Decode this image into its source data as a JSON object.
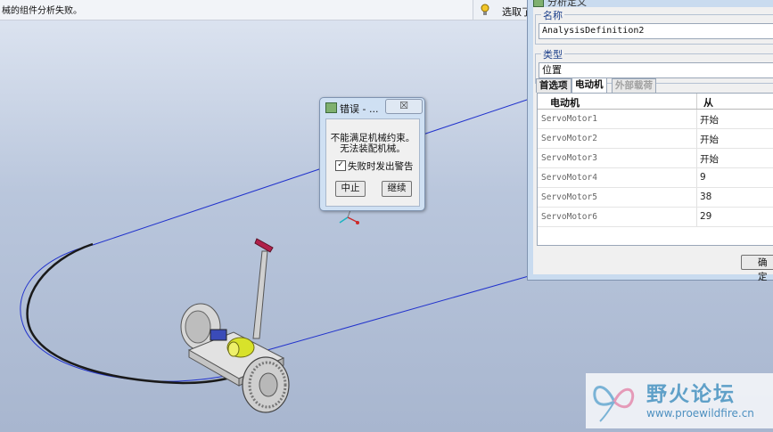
{
  "status_bar": {
    "message": "械的组件分析失败。",
    "select_label": "选取了"
  },
  "error_dialog": {
    "title": "错误 - ...",
    "close_glyph": "☒",
    "line1": "不能满足机械约束。",
    "line2": "无法装配机械。",
    "checkbox_label": "失败时发出警告",
    "checkbox_checked": true,
    "abort_button": "中止",
    "continue_button": "继续"
  },
  "analysis_dialog": {
    "title": "分析定义",
    "name_group_label": "名称",
    "name_value": "AnalysisDefinition2",
    "type_group_label": "类型",
    "type_value": "位置",
    "tabs": [
      {
        "label": "首选项",
        "active": false,
        "enabled": true
      },
      {
        "label": "电动机",
        "active": true,
        "enabled": true
      },
      {
        "label": "外部载荷",
        "active": false,
        "enabled": false
      }
    ],
    "table": {
      "col_motor": "电动机",
      "col_from": "从",
      "rows": [
        {
          "motor": "ServoMotor1",
          "from": "开始"
        },
        {
          "motor": "ServoMotor2",
          "from": "开始"
        },
        {
          "motor": "ServoMotor3",
          "from": "开始"
        },
        {
          "motor": "ServoMotor4",
          "from": "9"
        },
        {
          "motor": "ServoMotor5",
          "from": "38"
        },
        {
          "motor": "ServoMotor6",
          "from": "29"
        }
      ]
    },
    "ok_button": "确定"
  },
  "watermark": {
    "brand": "野火论坛",
    "url": "www.proewildfire.cn"
  },
  "colors": {
    "viewport_top": "#dfe6f2",
    "viewport_bottom": "#a8b6cf",
    "dialog_frame": "#c9dbef",
    "group_label": "#1c3f8a",
    "trajectory_line": "#1f2fbf"
  }
}
